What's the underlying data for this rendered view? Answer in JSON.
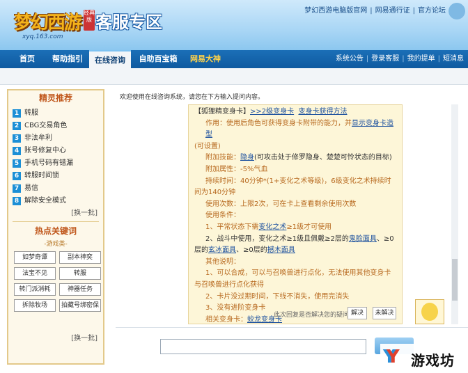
{
  "header": {
    "logo_text": "梦幻西游",
    "logo_badge": "经典版",
    "logo_url": "xyq.163.com",
    "page_title": "客服专区",
    "top_links": [
      "梦幻西游电脑版官网",
      "网易通行证",
      "官方论坛"
    ],
    "top_separator": "|"
  },
  "nav": {
    "tabs": [
      {
        "label": "首页"
      },
      {
        "label": "帮助指引"
      },
      {
        "label": "在线咨询"
      },
      {
        "label": "自助百宝箱"
      },
      {
        "label": "网易大神"
      }
    ],
    "right_links": [
      "系统公告",
      "登录客服",
      "我的提单",
      "短消息"
    ]
  },
  "sidebar": {
    "recommend_title": "精灵推荐",
    "items": [
      {
        "num": "1",
        "label": "转服"
      },
      {
        "num": "2",
        "label": "CBG交易角色"
      },
      {
        "num": "3",
        "label": "非法牟利"
      },
      {
        "num": "4",
        "label": "账号修复中心"
      },
      {
        "num": "5",
        "label": "手机号码有错漏"
      },
      {
        "num": "6",
        "label": "转服时间锁"
      },
      {
        "num": "7",
        "label": "易信"
      },
      {
        "num": "8",
        "label": "解除安全模式"
      }
    ],
    "refresh_1": "[换一批]",
    "hot_title": "热点关键词",
    "category": "-游戏类-",
    "keywords": [
      "如梦奇谭",
      "副本神奕",
      "法宝不见",
      "转服",
      "转门派消耗",
      "神器任务",
      "拆除牧场",
      "拍藏号绑密保"
    ],
    "refresh_2": "[换一批]"
  },
  "main": {
    "welcome": "欢迎使用在线咨询系统，请您在下方输入提问内容。",
    "answer": {
      "title_bracket": "【狐狸精变身卡】",
      "title_link_1": ">>2级变身卡",
      "title_link_2": "变身卡获得方法",
      "effect_prefix": "作用：使用后角色可获得变身卡附带的能力，并",
      "effect_link": "显示变身卡造型",
      "effect_suffix": "(可设置)",
      "skill_prefix": "附加技能：",
      "skill_link": "隐身",
      "skill_suffix": "(可攻击处于修罗隐身、楚楚可怜状态的目标)",
      "attr": "附加属性：-5%气血",
      "duration_1": "持续时间：40分钟*(1+变化之术等级)，6级变化之术持续时",
      "duration_2": "间为140分钟",
      "uses": "使用次数：上限2次，可在卡上查看剩余使用次数",
      "cond_title": "使用条件：",
      "cond_1_prefix": "1、平常状态下需",
      "cond_1_link": "变化之术",
      "cond_1_suffix": "≥1级才可使用",
      "cond_2_prefix": "2、战斗中使用，变化之术≥1级且佩戴≥2层的",
      "cond_2_link1": "鬼脸面具",
      "cond_2_mid": "、≥0",
      "cond_2b_prefix": "层的",
      "cond_2b_link1": "玄冰面具",
      "cond_2b_mid": "、≥0层的",
      "cond_2b_link2": "撼木面具",
      "notes_title": "其他说明：",
      "note_1a": "1、可以合成，可以与召唤兽进行点化，无法使用其他变身卡",
      "note_1b": "与召唤兽进行点化获得",
      "note_2": "2、卡片没过期时间，下线不消失，使用完消失",
      "note_3": "3、没有进阶变身卡",
      "related_prefix": "相关变身卡：",
      "related_link": "蛟龙变身卡"
    },
    "feedback_question": "此次回复是否解决您的疑问：",
    "btn_solved": "解决",
    "btn_unsolved": "未解决"
  },
  "watermark": {
    "text": "游戏坊"
  }
}
